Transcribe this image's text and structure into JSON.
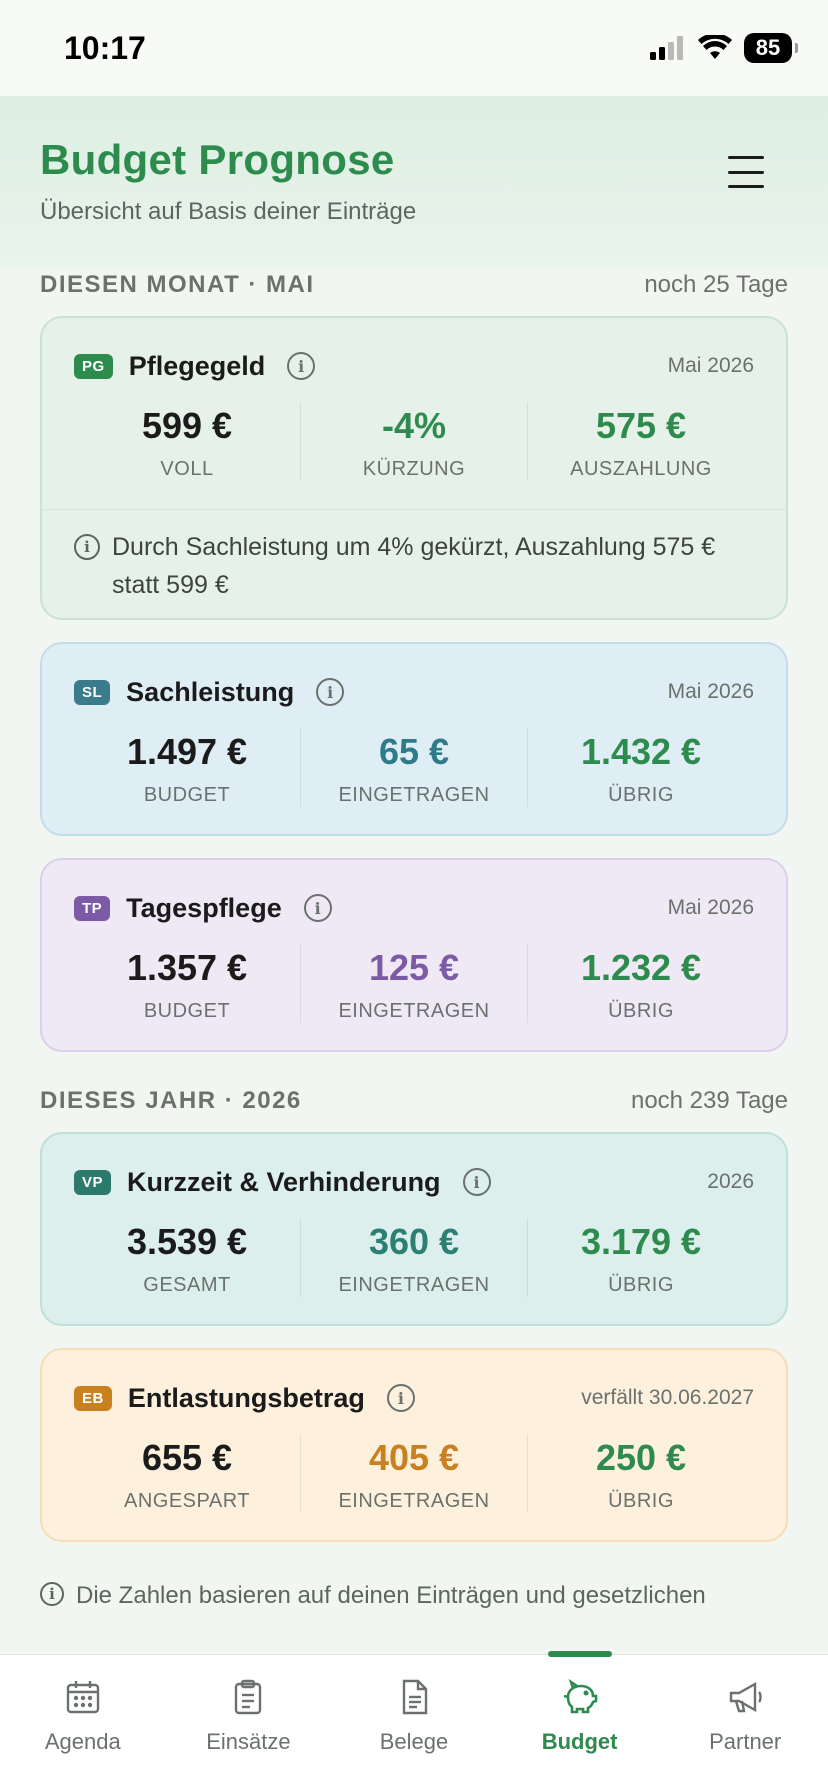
{
  "status_bar": {
    "time": "10:17",
    "battery": "85"
  },
  "header": {
    "title": "Budget Prognose",
    "subtitle": "Übersicht auf Basis deiner Einträge"
  },
  "month_section": {
    "title": "DIESEN MONAT · MAI",
    "remaining": "noch 25 Tage"
  },
  "year_section": {
    "title": "DIESES JAHR · 2026",
    "remaining": "noch 239 Tage"
  },
  "cards": {
    "pg": {
      "badge": "PG",
      "name": "Pflegegeld",
      "date": "Mai 2026",
      "stats": [
        {
          "value": "599 €",
          "label": "VOLL"
        },
        {
          "value": "-4%",
          "label": "KÜRZUNG"
        },
        {
          "value": "575 €",
          "label": "AUSZAHLUNG"
        }
      ],
      "note": "Durch Sachleistung um 4% gekürzt, Auszahlung 575 € statt 599 €"
    },
    "sl": {
      "badge": "SL",
      "name": "Sachleistung",
      "date": "Mai 2026",
      "stats": [
        {
          "value": "1.497 €",
          "label": "BUDGET"
        },
        {
          "value": "65 €",
          "label": "EINGETRAGEN"
        },
        {
          "value": "1.432 €",
          "label": "ÜBRIG"
        }
      ]
    },
    "tp": {
      "badge": "TP",
      "name": "Tagespflege",
      "date": "Mai 2026",
      "stats": [
        {
          "value": "1.357 €",
          "label": "BUDGET"
        },
        {
          "value": "125 €",
          "label": "EINGETRAGEN"
        },
        {
          "value": "1.232 €",
          "label": "ÜBRIG"
        }
      ]
    },
    "vp": {
      "badge": "VP",
      "name": "Kurzzeit & Verhinderung",
      "date": "2026",
      "stats": [
        {
          "value": "3.539 €",
          "label": "GESAMT"
        },
        {
          "value": "360 €",
          "label": "EINGETRAGEN"
        },
        {
          "value": "3.179 €",
          "label": "ÜBRIG"
        }
      ]
    },
    "eb": {
      "badge": "EB",
      "name": "Entlastungsbetrag",
      "date": "verfällt 30.06.2027",
      "stats": [
        {
          "value": "655 €",
          "label": "ANGESPART"
        },
        {
          "value": "405 €",
          "label": "EINGETRAGEN"
        },
        {
          "value": "250 €",
          "label": "ÜBRIG"
        }
      ]
    }
  },
  "footer_note": "Die Zahlen basieren auf deinen Einträgen und gesetzlichen",
  "nav": {
    "items": [
      {
        "label": "Agenda",
        "icon": "calendar-icon"
      },
      {
        "label": "Einsätze",
        "icon": "clipboard-icon"
      },
      {
        "label": "Belege",
        "icon": "document-icon"
      },
      {
        "label": "Budget",
        "icon": "piggy-bank-icon",
        "active": true
      },
      {
        "label": "Partner",
        "icon": "megaphone-icon"
      }
    ]
  },
  "colors": {
    "accent": "#2e8b4e",
    "badge_pg": "#2e8b4e",
    "badge_sl": "#3a7c8c",
    "badge_tp": "#7b5aa6",
    "badge_vp": "#2b7a6c",
    "badge_eb": "#c9801e"
  }
}
